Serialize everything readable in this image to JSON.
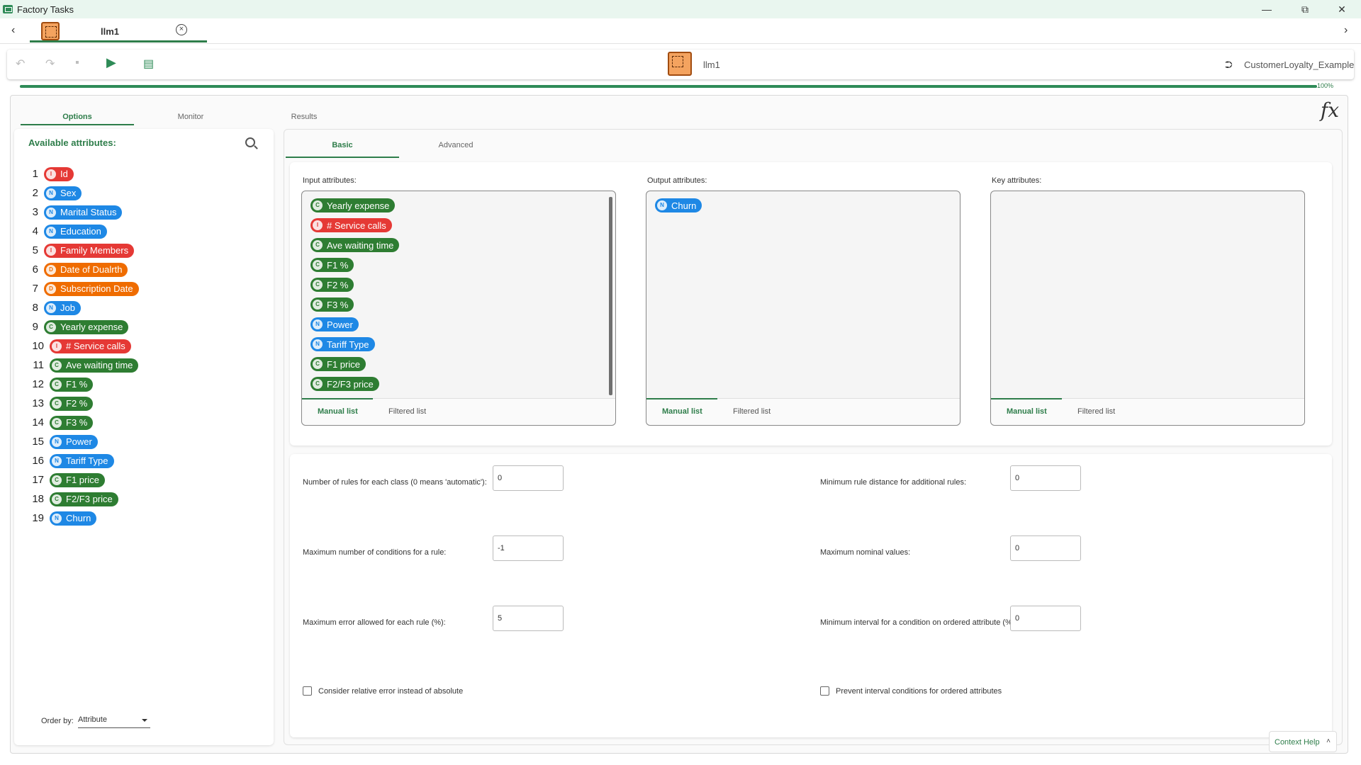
{
  "window": {
    "title": "Factory Tasks",
    "controls": {
      "minimize": "—",
      "restore": "⧉",
      "close": "✕"
    }
  },
  "tabstrip": {
    "back": "‹",
    "forward": "›",
    "tab_label": "llm1",
    "tab_close": "×"
  },
  "toolbar": {
    "undo": "↶",
    "redo": "↷",
    "save": "▪",
    "run": "▶",
    "doc": "▤",
    "task_name": "llm1",
    "project_icon": "⮊",
    "project_name": "CustomerLoyalty_Example"
  },
  "progress": {
    "value": 100,
    "label": "100%"
  },
  "main_tabs": [
    "Options",
    "Monitor",
    "Results"
  ],
  "fx_label": "fx",
  "attributes_panel": {
    "title": "Available attributes:",
    "items": [
      {
        "num": "1",
        "type": "I",
        "name": "Id"
      },
      {
        "num": "2",
        "type": "N",
        "name": "Sex"
      },
      {
        "num": "3",
        "type": "N",
        "name": "Marital Status"
      },
      {
        "num": "4",
        "type": "N",
        "name": "Education"
      },
      {
        "num": "5",
        "type": "I",
        "name": "Family Members"
      },
      {
        "num": "6",
        "type": "D",
        "name": "Date of Dualrth"
      },
      {
        "num": "7",
        "type": "D",
        "name": "Subscription Date"
      },
      {
        "num": "8",
        "type": "N",
        "name": "Job"
      },
      {
        "num": "9",
        "type": "C",
        "name": "Yearly expense"
      },
      {
        "num": "10",
        "type": "I",
        "name": "# Service calls"
      },
      {
        "num": "11",
        "type": "C",
        "name": "Ave waiting time"
      },
      {
        "num": "12",
        "type": "C",
        "name": "F1 %"
      },
      {
        "num": "13",
        "type": "C",
        "name": "F2 %"
      },
      {
        "num": "14",
        "type": "C",
        "name": "F3 %"
      },
      {
        "num": "15",
        "type": "N",
        "name": "Power"
      },
      {
        "num": "16",
        "type": "N",
        "name": "Tariff Type"
      },
      {
        "num": "17",
        "type": "C",
        "name": "F1 price"
      },
      {
        "num": "18",
        "type": "C",
        "name": "F2/F3 price"
      },
      {
        "num": "19",
        "type": "N",
        "name": "Churn"
      }
    ],
    "order_by_label": "Order by:",
    "order_by_value": "Attribute"
  },
  "sub_tabs": [
    "Basic",
    "Advanced"
  ],
  "attribute_boxes": [
    {
      "label": "Input attributes:",
      "chips": [
        {
          "type": "C",
          "name": "Yearly expense"
        },
        {
          "type": "I",
          "name": "# Service calls"
        },
        {
          "type": "C",
          "name": "Ave waiting time"
        },
        {
          "type": "C",
          "name": "F1 %"
        },
        {
          "type": "C",
          "name": "F2 %"
        },
        {
          "type": "C",
          "name": "F3 %"
        },
        {
          "type": "N",
          "name": "Power"
        },
        {
          "type": "N",
          "name": "Tariff Type"
        },
        {
          "type": "C",
          "name": "F1 price"
        },
        {
          "type": "C",
          "name": "F2/F3 price"
        }
      ],
      "tabs": [
        "Manual list",
        "Filtered list"
      ]
    },
    {
      "label": "Output attributes:",
      "chips": [
        {
          "type": "N",
          "name": "Churn"
        }
      ],
      "tabs": [
        "Manual list",
        "Filtered list"
      ]
    },
    {
      "label": "Key attributes:",
      "chips": [],
      "tabs": [
        "Manual list",
        "Filtered list"
      ]
    }
  ],
  "params": {
    "rules_per_class": {
      "label": "Number of rules for each class (0 means 'automatic'):",
      "value": "0"
    },
    "min_rule_distance": {
      "label": "Minimum rule distance for additional rules:",
      "value": "0"
    },
    "max_conditions": {
      "label": "Maximum number of conditions for a rule:",
      "value": "-1"
    },
    "max_nominal": {
      "label": "Maximum nominal values:",
      "value": "0"
    },
    "max_error": {
      "label": "Maximum error allowed for each rule (%):",
      "value": "5"
    },
    "min_interval": {
      "label": "Minimum interval for a condition on ordered attribute (%):",
      "value": "0"
    },
    "relative_error": {
      "label": "Consider relative error instead of absolute",
      "checked": false
    },
    "prevent_interval": {
      "label": "Prevent interval conditions for ordered attributes",
      "checked": false
    }
  },
  "context_help": {
    "label": "Context Help",
    "chevron": "˄"
  }
}
